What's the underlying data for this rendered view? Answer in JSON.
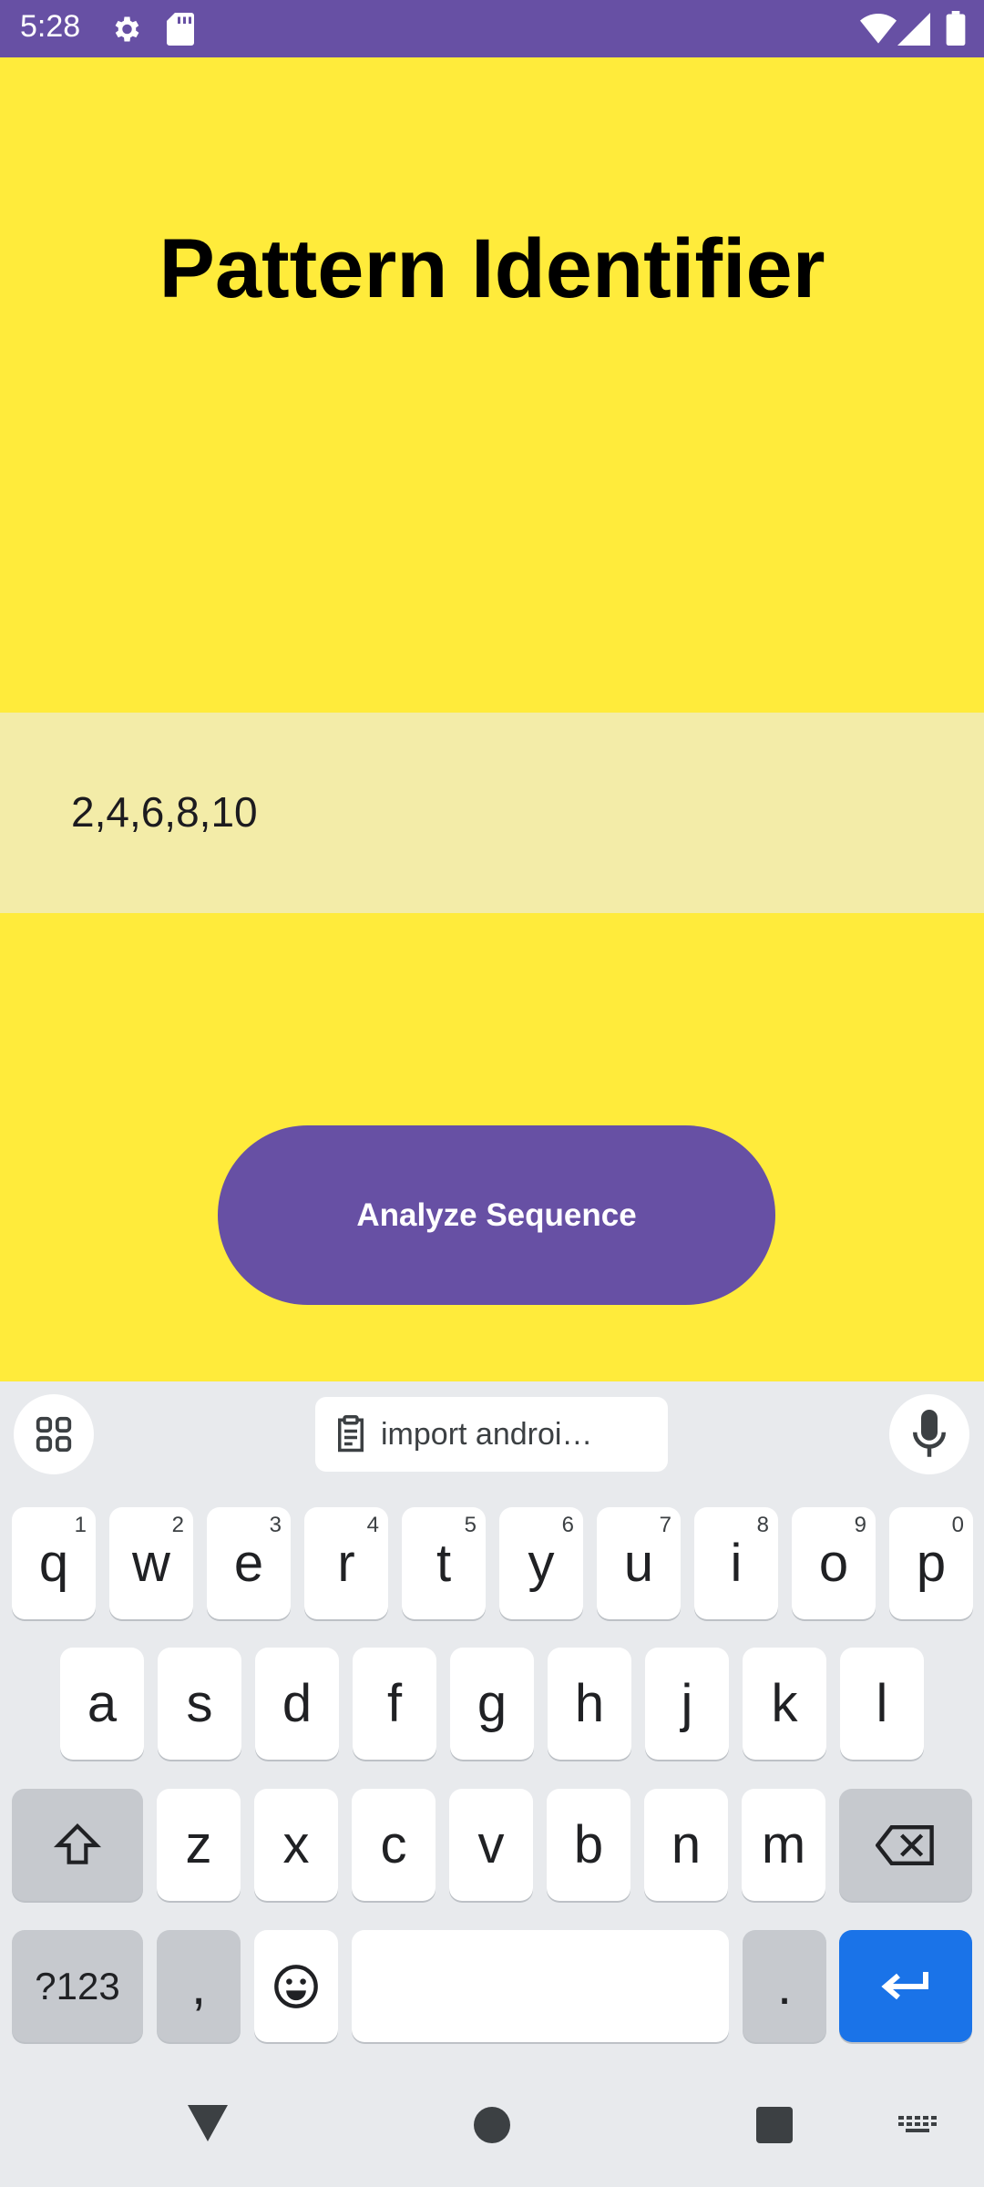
{
  "status": {
    "time": "5:28"
  },
  "app": {
    "title": "Pattern Identifier",
    "input_value": "2,4,6,8,10",
    "button_label": "Analyze Sequence"
  },
  "keyboard": {
    "clipboard_text": "import androi…",
    "row1": [
      {
        "k": "q",
        "h": "1"
      },
      {
        "k": "w",
        "h": "2"
      },
      {
        "k": "e",
        "h": "3"
      },
      {
        "k": "r",
        "h": "4"
      },
      {
        "k": "t",
        "h": "5"
      },
      {
        "k": "y",
        "h": "6"
      },
      {
        "k": "u",
        "h": "7"
      },
      {
        "k": "i",
        "h": "8"
      },
      {
        "k": "o",
        "h": "9"
      },
      {
        "k": "p",
        "h": "0"
      }
    ],
    "row2": [
      "a",
      "s",
      "d",
      "f",
      "g",
      "h",
      "j",
      "k",
      "l"
    ],
    "row3": [
      "z",
      "x",
      "c",
      "v",
      "b",
      "n",
      "m"
    ],
    "symbols_label": "?123",
    "comma": ",",
    "period": "."
  },
  "colors": {
    "app_bg": "#ffeb3b",
    "accent": "#6750a4",
    "field_bg": "#f3eca8",
    "enter_key": "#1a73e8"
  }
}
